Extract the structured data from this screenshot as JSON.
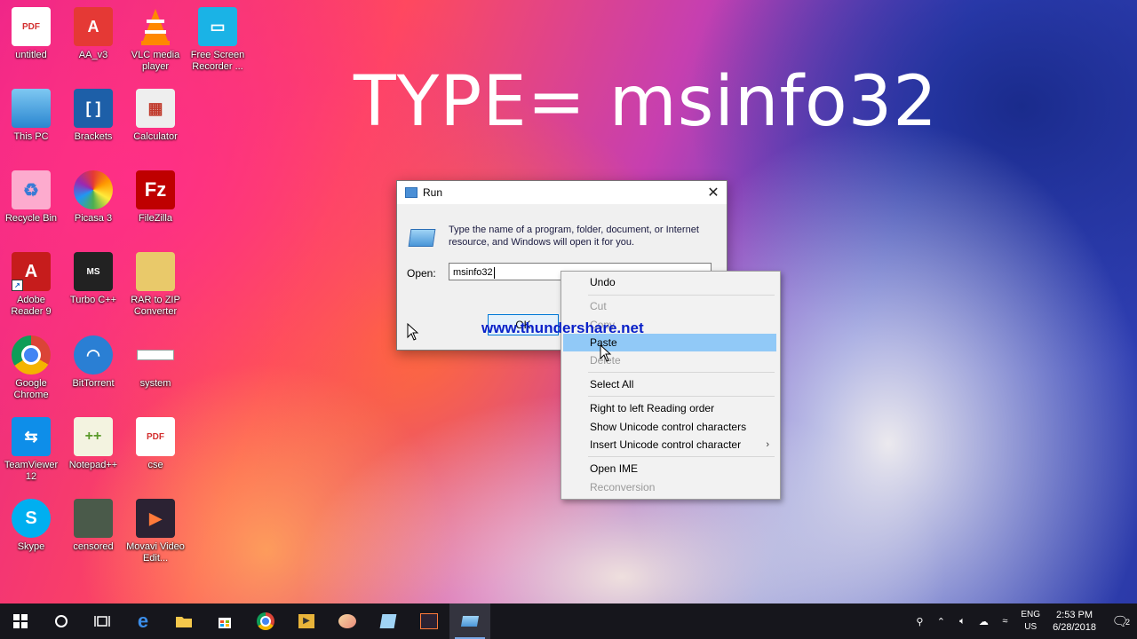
{
  "overlay_text": "TYPE= msinfo32",
  "watermark": "www.thundershare.net",
  "desktop_icons": [
    {
      "label": "untitled",
      "icon": "pdf-icon"
    },
    {
      "label": "AA_v3",
      "icon": "app-icon"
    },
    {
      "label": "VLC media player",
      "icon": "vlc-icon"
    },
    {
      "label": "Free Screen Recorder ...",
      "icon": "recorder-icon"
    },
    {
      "label": "This PC",
      "icon": "computer-icon"
    },
    {
      "label": "Brackets",
      "icon": "brackets-icon"
    },
    {
      "label": "Calculator",
      "icon": "calculator-icon"
    },
    {
      "label": "Recycle Bin",
      "icon": "recycle-bin-icon"
    },
    {
      "label": "Picasa 3",
      "icon": "picasa-icon"
    },
    {
      "label": "FileZilla",
      "icon": "filezilla-icon"
    },
    {
      "label": "Adobe Reader 9",
      "icon": "adobe-reader-icon"
    },
    {
      "label": "Turbo C++",
      "icon": "turbo-cpp-icon"
    },
    {
      "label": "RAR to ZIP Converter",
      "icon": "rar-zip-icon"
    },
    {
      "label": "Google Chrome",
      "icon": "chrome-icon"
    },
    {
      "label": "BitTorrent",
      "icon": "bittorrent-icon"
    },
    {
      "label": "system",
      "icon": "file-icon"
    },
    {
      "label": "TeamViewer 12",
      "icon": "teamviewer-icon"
    },
    {
      "label": "Notepad++",
      "icon": "notepad-plus-icon"
    },
    {
      "label": "cse",
      "icon": "pdf-icon"
    },
    {
      "label": "Skype",
      "icon": "skype-icon"
    },
    {
      "label": "censored",
      "icon": "image-icon"
    },
    {
      "label": "Movavi Video Edit...",
      "icon": "movavi-icon"
    }
  ],
  "run_dialog": {
    "title": "Run",
    "description": "Type the name of a program, folder, document, or Internet resource, and Windows will open it for you.",
    "open_label": "Open:",
    "open_value": "msinfo32",
    "ok_label": "OK"
  },
  "context_menu": {
    "items": [
      {
        "label": "Undo",
        "enabled": true
      },
      {
        "label": "Cut",
        "enabled": false
      },
      {
        "label": "Copy",
        "enabled": false
      },
      {
        "label": "Paste",
        "enabled": true,
        "highlighted": true
      },
      {
        "label": "Delete",
        "enabled": false
      },
      {
        "label": "Select All",
        "enabled": true
      },
      {
        "label": "Right to left Reading order",
        "enabled": true
      },
      {
        "label": "Show Unicode control characters",
        "enabled": true
      },
      {
        "label": "Insert Unicode control character",
        "enabled": true,
        "submenu": true
      },
      {
        "label": "Open IME",
        "enabled": true
      },
      {
        "label": "Reconversion",
        "enabled": false
      }
    ]
  },
  "taskbar": {
    "tray": {
      "language_top": "ENG",
      "language_bottom": "US",
      "time": "2:53 PM",
      "date": "6/28/2018",
      "notification_count": "2"
    }
  },
  "colors": {
    "accent": "#0078d7",
    "menu_highlight": "#91c9f7",
    "watermark": "#0a21c8"
  }
}
